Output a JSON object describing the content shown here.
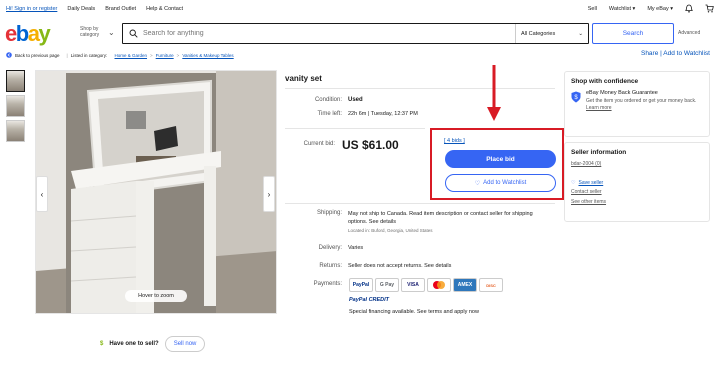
{
  "topbar": {
    "left": [
      "Hi! Sign in or register",
      "Daily Deals",
      "Brand Outlet",
      "Help & Contact"
    ],
    "right": [
      "Sell",
      "Watchlist ▾",
      "My eBay ▾"
    ]
  },
  "header": {
    "logo": {
      "e": "e",
      "b": "b",
      "a": "a",
      "y": "y"
    },
    "shop_by": "Shop by category",
    "search_placeholder": "Search for anything",
    "category": "All Categories",
    "search_button": "Search",
    "advanced": "Advanced"
  },
  "breadcrumb": {
    "back": "Back to previous page",
    "items": [
      "Listed in category:",
      "Home & Garden",
      "Furniture",
      "Vanities & Makeup Tables"
    ]
  },
  "share": "Share | Add to Watchlist",
  "gallery": {
    "hover_zoom": "Hover to zoom"
  },
  "sell_one": {
    "text": "Have one to sell?",
    "button": "Sell now"
  },
  "item": {
    "title": "vanity set",
    "condition_label": "Condition:",
    "condition": "Used",
    "time_left_label": "Time left:",
    "time_left": "22h 6m | Tuesday, 12:37 PM",
    "current_bid_label": "Current bid:",
    "current_bid": "US $61.00",
    "bids": "[ 4 bids ]",
    "place_bid": "Place bid",
    "add_watchlist": "Add to Watchlist",
    "shipping_label": "Shipping:",
    "shipping": "May not ship to Canada. Read item description or contact seller for shipping options. See details",
    "location": "Located in: Buford, Georgia, United States",
    "delivery_label": "Delivery:",
    "delivery": "Varies",
    "returns_label": "Returns:",
    "returns": "Seller does not accept returns. See details",
    "payments_label": "Payments:",
    "payments": [
      "PayPal",
      "G Pay",
      "VISA",
      "MC",
      "AMEX",
      "DISC"
    ],
    "paypal_credit": "PayPal CREDIT",
    "financing": "Special financing available. See terms and apply now"
  },
  "confidence": {
    "title": "Shop with confidence",
    "guarantee_title": "eBay Money Back Guarantee",
    "guarantee_text": "Get the item you ordered or get your money back.",
    "learn_more": "Learn more"
  },
  "seller": {
    "title": "Seller information",
    "name": "bdar-2004 (0)",
    "save": "Save seller",
    "contact": "Contact seller",
    "other": "See other items"
  },
  "colors": {
    "accent": "#3665f3",
    "highlight": "#d81b25"
  }
}
